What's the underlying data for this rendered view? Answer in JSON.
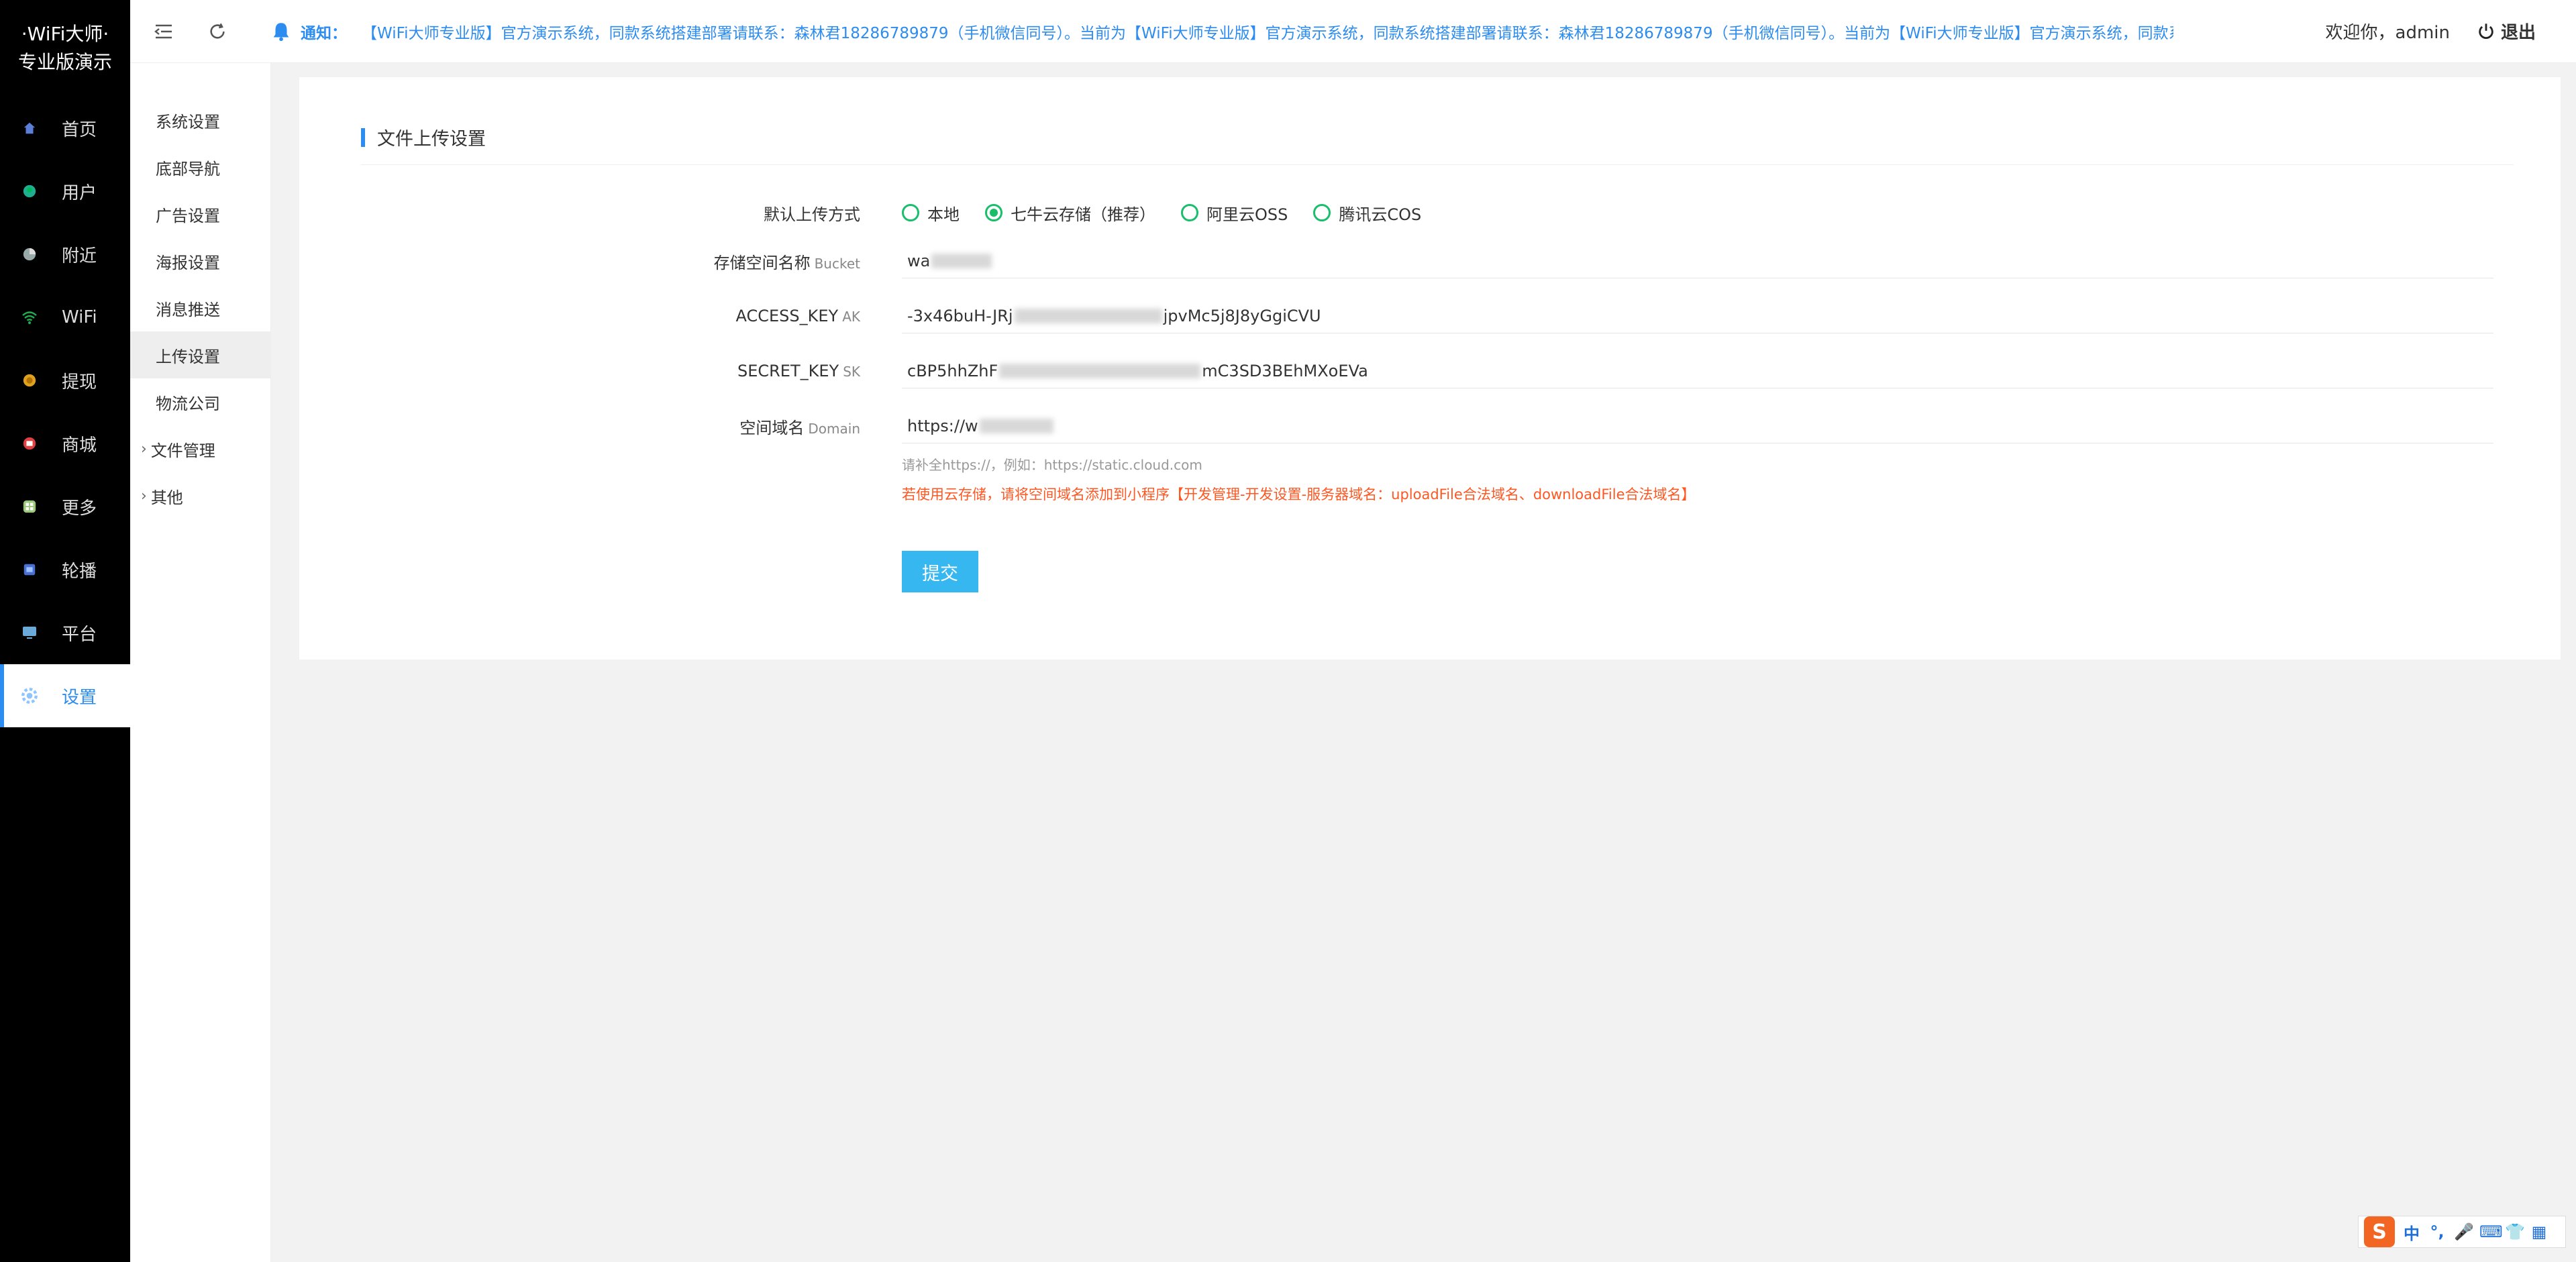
{
  "app": {
    "logo_line1": "·WiFi大师·",
    "logo_line2": "专业版演示"
  },
  "sidebar": {
    "items": [
      {
        "label": "首页",
        "icon": "home-icon"
      },
      {
        "label": "用户",
        "icon": "user-icon"
      },
      {
        "label": "附近",
        "icon": "nearby-icon"
      },
      {
        "label": "WiFi",
        "icon": "wifi-icon"
      },
      {
        "label": "提现",
        "icon": "coin-icon"
      },
      {
        "label": "商城",
        "icon": "shop-icon"
      },
      {
        "label": "更多",
        "icon": "grid-icon"
      },
      {
        "label": "轮播",
        "icon": "carousel-icon"
      },
      {
        "label": "平台",
        "icon": "monitor-icon"
      },
      {
        "label": "设置",
        "icon": "gear-icon",
        "active": true
      }
    ]
  },
  "submenu": {
    "title": "设置",
    "items": [
      {
        "label": "系统设置"
      },
      {
        "label": "底部导航"
      },
      {
        "label": "广告设置"
      },
      {
        "label": "海报设置"
      },
      {
        "label": "消息推送"
      },
      {
        "label": "上传设置",
        "active": true
      },
      {
        "label": "物流公司"
      }
    ],
    "groups": [
      {
        "label": "文件管理"
      },
      {
        "label": "其他"
      }
    ]
  },
  "topbar": {
    "notice_label": "通知：",
    "notice_text": "【WiFi大师专业版】官方演示系统，同款系统搭建部署请联系：森林君18286789879（手机微信同号）。当前为【WiFi大师专业版】官方演示系统，同款系统搭建部署请联系：森林君18286789879（手机微信同号）。当前为【WiFi大师专业版】官方演示系统，同款系",
    "welcome": "欢迎你，admin",
    "logout": "退出"
  },
  "form": {
    "section_title": "文件上传设置",
    "upload_method_label": "默认上传方式",
    "upload_methods": [
      {
        "label": "本地",
        "checked": false
      },
      {
        "label": "七牛云存储（推荐）",
        "checked": true
      },
      {
        "label": "阿里云OSS",
        "checked": false
      },
      {
        "label": "腾讯云COS",
        "checked": false
      }
    ],
    "bucket_label": "存储空间名称",
    "bucket_sub": "Bucket",
    "bucket_value_start": "wa",
    "bucket_value_end": "",
    "ak_label": "ACCESS_KEY",
    "ak_sub": "AK",
    "ak_value_start": "-3x46buH-JRj",
    "ak_value_end": "jpvMc5j8J8yGgiCVU",
    "sk_label": "SECRET_KEY",
    "sk_sub": "SK",
    "sk_value_start": "cBP5hhZhF",
    "sk_value_end": "mC3SD3BEhMXoEVa",
    "domain_label": "空间域名",
    "domain_sub": "Domain",
    "domain_value_start": "https://w",
    "domain_value_end": "",
    "domain_hint": "请补全https://，例如：https://static.cloud.com",
    "domain_warning": "若使用云存储，请将空间域名添加到小程序【开发管理-开发设置-服务器域名：uploadFile合法域名、downloadFile合法域名】",
    "submit": "提交"
  },
  "ime": {
    "logo": "S",
    "items": [
      "中",
      "°,",
      "🎤",
      "⌨",
      "👕",
      "▦"
    ]
  },
  "colors": {
    "accent": "#2d8cf0",
    "radio": "#19be6b",
    "submit": "#36b7f0",
    "warning": "#ff5722"
  }
}
